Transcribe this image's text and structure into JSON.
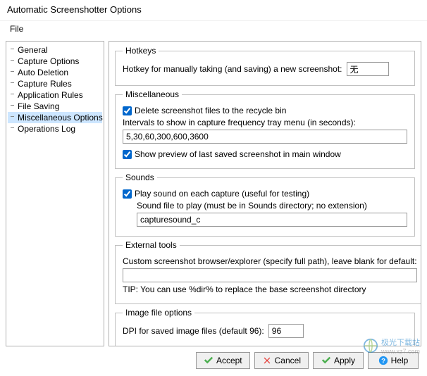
{
  "window": {
    "title": "Automatic Screenshotter Options"
  },
  "menu": {
    "file": "File"
  },
  "sidebar": {
    "items": [
      {
        "label": "General"
      },
      {
        "label": "Capture Options"
      },
      {
        "label": "Auto Deletion"
      },
      {
        "label": "Capture Rules"
      },
      {
        "label": "Application Rules"
      },
      {
        "label": "File Saving"
      },
      {
        "label": "Miscellaneous Options",
        "selected": true
      },
      {
        "label": "Operations Log"
      }
    ]
  },
  "hotkeys": {
    "legend": "Hotkeys",
    "label": "Hotkey for manually taking (and saving) a new screenshot:",
    "value": "无"
  },
  "misc": {
    "legend": "Miscellaneous",
    "recycle_label": "Delete screenshot files to the recycle bin",
    "recycle_checked": true,
    "intervals_label": "Intervals to show in capture frequency tray menu (in seconds):",
    "intervals_value": "5,30,60,300,600,3600",
    "preview_label": "Show preview of last saved screenshot in main window",
    "preview_checked": true
  },
  "sounds": {
    "legend": "Sounds",
    "play_label": "Play sound on each capture (useful for testing)",
    "play_checked": true,
    "file_label": "Sound file to play (must be in Sounds directory; no extension)",
    "file_value": "capturesound_c"
  },
  "external": {
    "legend": "External tools",
    "browser_label": "Custom screenshot browser/explorer (specify full path), leave blank for default:",
    "browser_value": "",
    "tip": "TIP: You can use %dir% to replace the base screenshot directory"
  },
  "image": {
    "legend": "Image file options",
    "dpi_label": "DPI for saved image files (default 96):",
    "dpi_value": "96"
  },
  "buttons": {
    "accept": "Accept",
    "cancel": "Cancel",
    "apply": "Apply",
    "help": "Help"
  },
  "watermark": {
    "text": "极光下载站",
    "sub": "www.xz7.com"
  }
}
